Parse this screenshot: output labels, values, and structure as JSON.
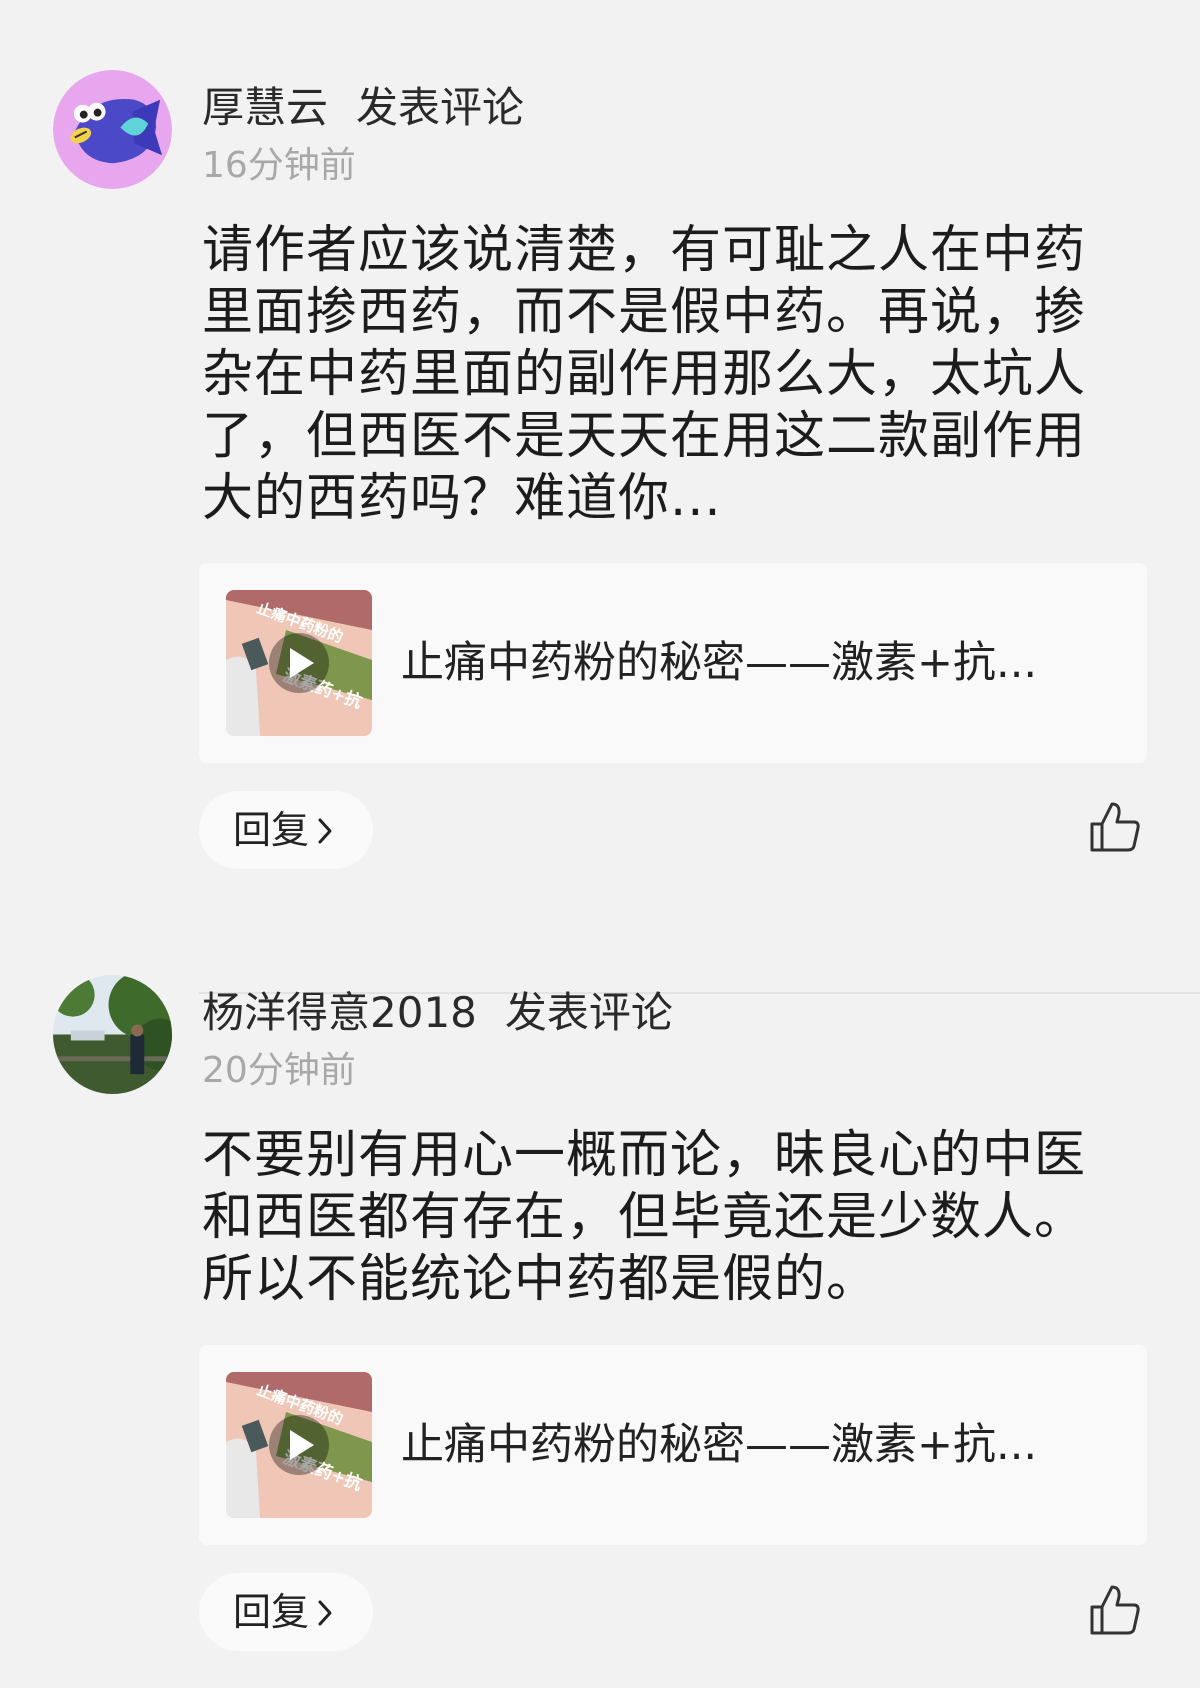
{
  "comments": [
    {
      "author": "厚慧云",
      "action": "发表评论",
      "time": "16分钟前",
      "text": "请作者应该说清楚，有可耻之人在中药里面掺西药，而不是假中药。再说，掺杂在中药里面的副作用那么大，太坑人了，但西医不是天天在用这二款副作用大的西药吗？难道你...",
      "card_title": "止痛中药粉的秘密——激素+抗...",
      "thumb_text_top": "止痛中药粉的",
      "thumb_text_bottom": "激素药+抗",
      "reply_label": "回复"
    },
    {
      "author": "杨洋得意2018",
      "action": "发表评论",
      "time": "20分钟前",
      "text": "不要别有用心一概而论，昧良心的中医和西医都有存在，但毕竟还是少数人。所以不能统论中药都是假的。",
      "card_title": "止痛中药粉的秘密——激素+抗...",
      "thumb_text_top": "止痛中药粉的",
      "thumb_text_bottom": "激素药+抗",
      "reply_label": "回复"
    }
  ],
  "icons": {
    "like": "thumbs-up-icon",
    "chevron": "chevron-right-icon",
    "play": "play-icon"
  },
  "colors": {
    "background": "#f2f2f2",
    "card": "#f9f9f9",
    "time": "#a8a8a8",
    "avatar1_bg": "#e7a6ee",
    "avatar1_fish": "#4b49c8"
  }
}
